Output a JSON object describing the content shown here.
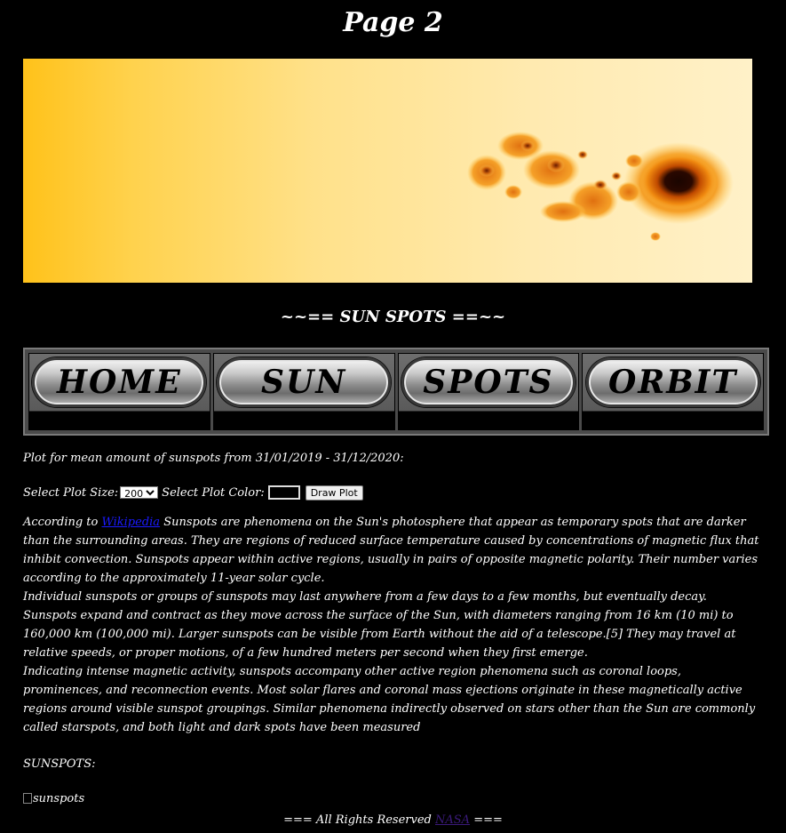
{
  "header": {
    "title": "Page 2"
  },
  "banner": {
    "image_name": "sun-spots-banner"
  },
  "section": {
    "title": "~~== SUN SPOTS ==~~"
  },
  "nav": {
    "items": [
      {
        "label": "HOME"
      },
      {
        "label": "SUN"
      },
      {
        "label": "SPOTS"
      },
      {
        "label": "ORBIT"
      }
    ]
  },
  "plot": {
    "title": "Plot for mean amount of sunspots from 31/01/2019 - 31/12/2020:",
    "size_label": "Select Plot Size:",
    "size_value": "200",
    "color_label": "Select Plot Color:",
    "color_value": "#000000",
    "draw_button": "Draw Plot"
  },
  "description": {
    "lead": "According to ",
    "link": "Wikipedia",
    "p1": " Sunspots are phenomena on the Sun's photosphere that appear as temporary spots that are darker than the surrounding areas. They are regions of reduced surface temperature caused by concentrations of magnetic flux that inhibit convection. Sunspots appear within active regions, usually in pairs of opposite magnetic polarity. Their number varies according to the approximately 11-year solar cycle.",
    "p2": "Individual sunspots or groups of sunspots may last anywhere from a few days to a few months, but eventually decay. Sunspots expand and contract as they move across the surface of the Sun, with diameters ranging from 16 km (10 mi) to 160,000 km (100,000 mi). Larger sunspots can be visible from Earth without the aid of a telescope.[5] They may travel at relative speeds, or proper motions, of a few hundred meters per second when they first emerge.",
    "p3": "Indicating intense magnetic activity, sunspots accompany other active region phenomena such as coronal loops, prominences, and reconnection events. Most solar flares and coronal mass ejections originate in these magnetically active regions around visible sunspot groupings. Similar phenomena indirectly observed on stars other than the Sun are commonly called starspots, and both light and dark spots have been measured"
  },
  "sunspots": {
    "label": "SUNSPOTS:",
    "img_alt": "sunspots"
  },
  "footer": {
    "prefix": "=== All Rights Reserved ",
    "link": "NASA",
    "suffix": " ==="
  }
}
